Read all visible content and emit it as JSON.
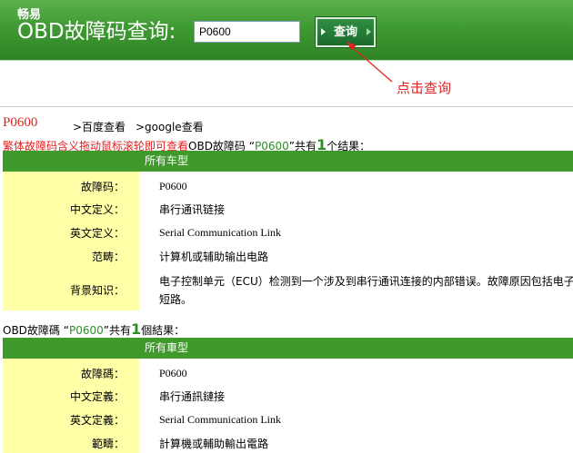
{
  "header": {
    "brand": "畅易",
    "title": "OBD故障码查询:",
    "input_value": "P0600",
    "query_label": "查询",
    "annotation": "点击查询"
  },
  "links": {
    "code": "P0600",
    "baidu": ">百度查看",
    "google": ">google查看"
  },
  "notice": {
    "red_text": "繁体故障码含义拖动鼠标滚轮即可查看",
    "mid_text": "OBD故障码 “",
    "code": "P0600",
    "after_code": "”共有",
    "count": "1",
    "end_text": "个结果："
  },
  "simplified": {
    "section_title": "所有车型",
    "rows": [
      {
        "label": "故障码：",
        "value": "P0600"
      },
      {
        "label": "中文定义：",
        "value": "串行通讯链接"
      },
      {
        "label": "英文定义：",
        "value": "Serial Communication Link"
      },
      {
        "label": "范畴：",
        "value": "计算机或辅助输出电路"
      },
      {
        "label": "背景知识：",
        "value": "电子控制单元（ECU）检测到一个涉及到串行通讯连接的内部错误。故障原因包括电子",
        "value2": "短路。"
      }
    ]
  },
  "traditional_result": {
    "prefix": "OBD故障碼 “",
    "code": "P0600",
    "after_code": "”共有",
    "count": "1",
    "end_text": "個結果："
  },
  "traditional": {
    "section_title": "所有車型",
    "rows": [
      {
        "label": "故障碼：",
        "value": "P0600"
      },
      {
        "label": "中文定義：",
        "value": "串行通訊鏈接"
      },
      {
        "label": "英文定義：",
        "value": "Serial Communication Link"
      },
      {
        "label": "範疇：",
        "value": "計算機或輔助輸出電路"
      }
    ]
  },
  "colors": {
    "accent_green": "#3f9a2b",
    "label_bg": "#ffffa8",
    "highlight_red": "#e0221f"
  }
}
